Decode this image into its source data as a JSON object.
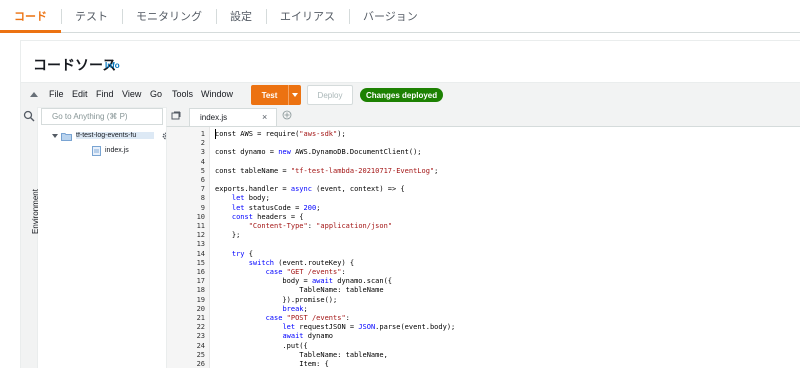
{
  "top_tabs": [
    {
      "label": "コード",
      "active": true
    },
    {
      "label": "テスト",
      "active": false
    },
    {
      "label": "モニタリング",
      "active": false
    },
    {
      "label": "設定",
      "active": false
    },
    {
      "label": "エイリアス",
      "active": false
    },
    {
      "label": "バージョン",
      "active": false
    }
  ],
  "section": {
    "title": "コードソース",
    "info": "Info"
  },
  "menu": {
    "items": [
      "File",
      "Edit",
      "Find",
      "View",
      "Go",
      "Tools",
      "Window"
    ],
    "test_label": "Test",
    "deploy_label": "Deploy",
    "status_badge": "Changes deployed"
  },
  "sidebar": {
    "environment_label": "Environment",
    "search_placeholder": "Go to Anything (⌘ P)",
    "folder": "tf-test-log-events-fu",
    "file": "index.js"
  },
  "editor": {
    "tab_name": "index.js",
    "lines": [
      [
        [
          "p",
          "const AWS = require("
        ],
        [
          "s",
          "\"aws-sdk\""
        ],
        [
          "p",
          ");"
        ]
      ],
      [],
      [
        [
          "p",
          "const dynamo = "
        ],
        [
          "k",
          "new"
        ],
        [
          "p",
          " AWS.DynamoDB.DocumentClient();"
        ]
      ],
      [],
      [
        [
          "p",
          "const tableName = "
        ],
        [
          "s",
          "\"tf-test-lambda-20210717-EventLog\""
        ],
        [
          "p",
          ";"
        ]
      ],
      [],
      [
        [
          "p",
          "exports.handler = "
        ],
        [
          "k",
          "async"
        ],
        [
          "p",
          " (event, context) => {"
        ]
      ],
      [
        [
          "p",
          "    "
        ],
        [
          "k",
          "let"
        ],
        [
          "p",
          " body;"
        ]
      ],
      [
        [
          "p",
          "    "
        ],
        [
          "k",
          "let"
        ],
        [
          "p",
          " statusCode = "
        ],
        [
          "k",
          "200"
        ],
        [
          "p",
          ";"
        ]
      ],
      [
        [
          "p",
          "    "
        ],
        [
          "k",
          "const"
        ],
        [
          "p",
          " headers = {"
        ]
      ],
      [
        [
          "p",
          "        "
        ],
        [
          "s",
          "\"Content-Type\""
        ],
        [
          "p",
          ": "
        ],
        [
          "s",
          "\"application/json\""
        ]
      ],
      [
        [
          "p",
          "    };"
        ]
      ],
      [],
      [
        [
          "p",
          "    "
        ],
        [
          "k",
          "try"
        ],
        [
          "p",
          " {"
        ]
      ],
      [
        [
          "p",
          "        "
        ],
        [
          "k",
          "switch"
        ],
        [
          "p",
          " (event.routeKey) {"
        ]
      ],
      [
        [
          "p",
          "            "
        ],
        [
          "k",
          "case"
        ],
        [
          "p",
          " "
        ],
        [
          "s",
          "\"GET /events\""
        ],
        [
          "p",
          ":"
        ]
      ],
      [
        [
          "p",
          "                body = "
        ],
        [
          "k",
          "await"
        ],
        [
          "p",
          " dynamo.scan({"
        ]
      ],
      [
        [
          "p",
          "                    TableName: tableName"
        ]
      ],
      [
        [
          "p",
          "                }).promise();"
        ]
      ],
      [
        [
          "p",
          "                "
        ],
        [
          "k",
          "break"
        ],
        [
          "p",
          ";"
        ]
      ],
      [
        [
          "p",
          "            "
        ],
        [
          "k",
          "case"
        ],
        [
          "p",
          " "
        ],
        [
          "s",
          "\"POST /events\""
        ],
        [
          "p",
          ":"
        ]
      ],
      [
        [
          "p",
          "                "
        ],
        [
          "k",
          "let"
        ],
        [
          "p",
          " requestJSON = "
        ],
        [
          "k",
          "JSON"
        ],
        [
          "p",
          ".parse(event.body);"
        ]
      ],
      [
        [
          "p",
          "                "
        ],
        [
          "k",
          "await"
        ],
        [
          "p",
          " dynamo"
        ]
      ],
      [
        [
          "p",
          "                .put({"
        ]
      ],
      [
        [
          "p",
          "                    TableName: tableName,"
        ]
      ],
      [
        [
          "p",
          "                    Item: {"
        ]
      ]
    ]
  },
  "colors": {
    "accent": "#ec7211",
    "success": "#1d8102",
    "link": "#0073bb"
  }
}
